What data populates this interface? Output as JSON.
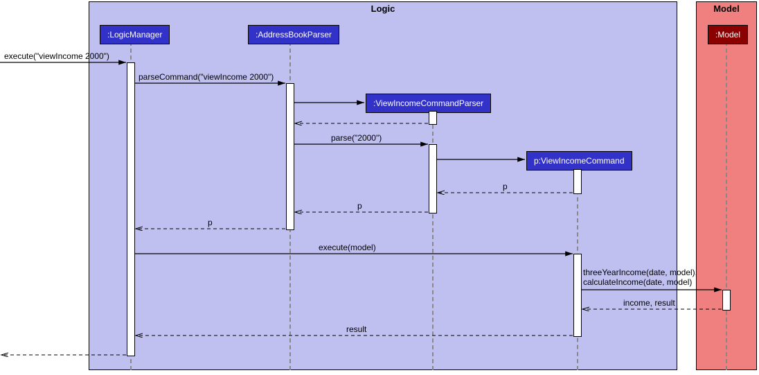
{
  "frames": {
    "logic": {
      "title": "Logic"
    },
    "model": {
      "title": "Model"
    }
  },
  "participants": {
    "logicManager": ":LogicManager",
    "addressBookParser": ":AddressBookParser",
    "viewIncomeCommandParser": ":ViewIncomeCommandParser",
    "viewIncomeCommand": "p:ViewIncomeCommand",
    "model": ":Model"
  },
  "messages": {
    "m1": "execute(\"viewIncome 2000\")",
    "m2": "parseCommand(\"viewIncome 2000\")",
    "m3": "parse(\"2000\")",
    "m4": "p",
    "m5": "p",
    "m6": "p",
    "m7": "execute(model)",
    "m8": "threeYearIncome(date, model), calculateIncome(date, model)",
    "m9": "income, result",
    "m10": "result"
  },
  "chart_data": {
    "type": "uml_sequence_diagram",
    "frames": [
      {
        "name": "Logic",
        "contains": [
          "LogicManager",
          "AddressBookParser",
          "ViewIncomeCommandParser",
          "ViewIncomeCommand"
        ]
      },
      {
        "name": "Model",
        "contains": [
          "Model"
        ]
      }
    ],
    "lifelines": [
      {
        "id": "actor",
        "label": ""
      },
      {
        "id": "LogicManager",
        "label": ":LogicManager"
      },
      {
        "id": "AddressBookParser",
        "label": ":AddressBookParser"
      },
      {
        "id": "ViewIncomeCommandParser",
        "label": ":ViewIncomeCommandParser"
      },
      {
        "id": "ViewIncomeCommand",
        "label": "p:ViewIncomeCommand"
      },
      {
        "id": "Model",
        "label": ":Model"
      }
    ],
    "messages": [
      {
        "from": "actor",
        "to": "LogicManager",
        "label": "execute(\"viewIncome 2000\")",
        "type": "sync"
      },
      {
        "from": "LogicManager",
        "to": "AddressBookParser",
        "label": "parseCommand(\"viewIncome 2000\")",
        "type": "sync"
      },
      {
        "from": "AddressBookParser",
        "to": "ViewIncomeCommandParser",
        "label": "",
        "type": "create"
      },
      {
        "from": "ViewIncomeCommandParser",
        "to": "AddressBookParser",
        "label": "",
        "type": "return"
      },
      {
        "from": "AddressBookParser",
        "to": "ViewIncomeCommandParser",
        "label": "parse(\"2000\")",
        "type": "sync"
      },
      {
        "from": "ViewIncomeCommandParser",
        "to": "ViewIncomeCommand",
        "label": "",
        "type": "create"
      },
      {
        "from": "ViewIncomeCommand",
        "to": "ViewIncomeCommandParser",
        "label": "p",
        "type": "return"
      },
      {
        "from": "ViewIncomeCommandParser",
        "to": "AddressBookParser",
        "label": "p",
        "type": "return"
      },
      {
        "from": "AddressBookParser",
        "to": "LogicManager",
        "label": "p",
        "type": "return"
      },
      {
        "from": "LogicManager",
        "to": "ViewIncomeCommand",
        "label": "execute(model)",
        "type": "sync"
      },
      {
        "from": "ViewIncomeCommand",
        "to": "Model",
        "label": "threeYearIncome(date, model), calculateIncome(date, model)",
        "type": "sync"
      },
      {
        "from": "Model",
        "to": "ViewIncomeCommand",
        "label": "income, result",
        "type": "return"
      },
      {
        "from": "ViewIncomeCommand",
        "to": "LogicManager",
        "label": "result",
        "type": "return"
      },
      {
        "from": "LogicManager",
        "to": "actor",
        "label": "",
        "type": "return"
      }
    ]
  }
}
